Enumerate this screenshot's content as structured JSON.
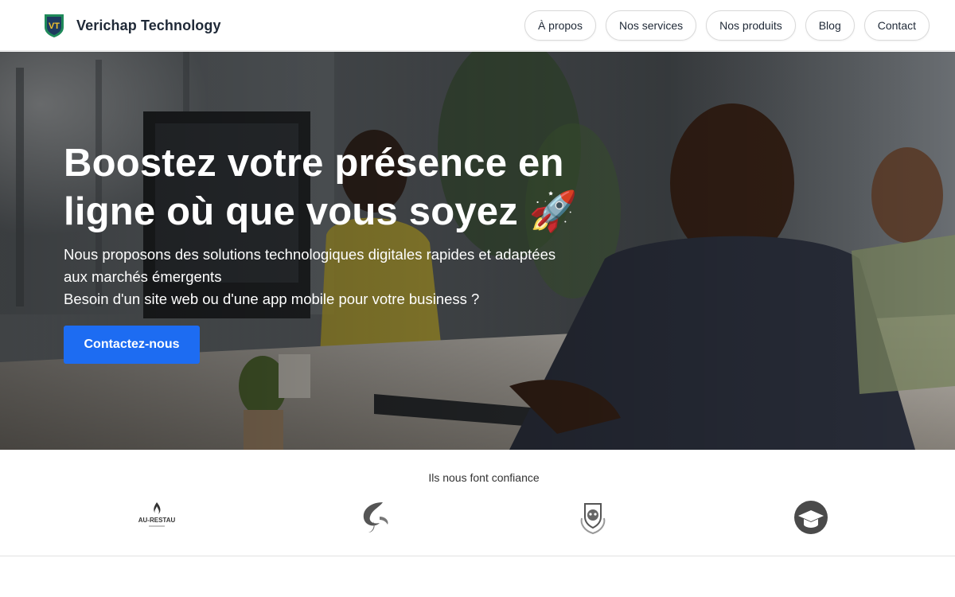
{
  "header": {
    "brand_name": "Verichap Technology",
    "logo_letters": "VT",
    "nav": [
      {
        "label": "À propos"
      },
      {
        "label": "Nos services"
      },
      {
        "label": "Nos produits"
      },
      {
        "label": "Blog"
      },
      {
        "label": "Contact"
      }
    ]
  },
  "hero": {
    "title_line1": "Boostez votre présence en",
    "title_line2": "ligne où que vous soyez 🚀",
    "subtitle_1": "Nous proposons des solutions technologiques digitales rapides et adaptées aux marchés émergents",
    "subtitle_2": "Besoin d'un site web ou d'une app mobile pour votre business ?",
    "cta_label": "Contactez-nous"
  },
  "trust": {
    "title": "Ils nous font confiance",
    "logos": [
      {
        "icon": "au-restau-logo",
        "text": "AU-RESTAU"
      },
      {
        "icon": "swirl-logo"
      },
      {
        "icon": "crest-logo"
      },
      {
        "icon": "graduation-cap-logo"
      }
    ]
  },
  "colors": {
    "accent": "#1d6cf2",
    "logo_green": "#1f8a5a",
    "logo_navy": "#1e3a5f",
    "logo_yellow": "#f2c12e"
  }
}
